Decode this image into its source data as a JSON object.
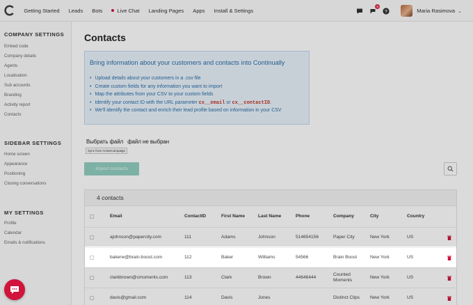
{
  "nav": {
    "items": [
      {
        "label": "Getting Started"
      },
      {
        "label": "Leads"
      },
      {
        "label": "Bots"
      },
      {
        "label": "Live Chat"
      },
      {
        "label": "Landing Pages"
      },
      {
        "label": "Apps"
      },
      {
        "label": "Install & Settings"
      }
    ],
    "notification_count": "5",
    "user_name": "Maria Rasimova"
  },
  "sidebar": {
    "company_heading": "COMPANY SETTINGS",
    "company_items": [
      "Embed code",
      "Company details",
      "Agents",
      "Localisation",
      "Sub accounts",
      "Branding",
      "Activity report",
      "Contacts"
    ],
    "sidebar_heading": "SIDEBAR SETTINGS",
    "sidebar_items": [
      "Home screen",
      "Appearance",
      "Positioning",
      "Closing conversations"
    ],
    "my_heading": "MY SETTINGS",
    "my_items": [
      "Profile",
      "Calendar",
      "Emails & notifications"
    ]
  },
  "main": {
    "title": "Contacts",
    "info_title": "Bring information about your customers and contacts into Continually",
    "info_items": {
      "upload": "Upload details about your customers in a .csv file",
      "fields": "Create custom fields for any information you want to import",
      "map": "Map the attributes from your CSV to your custom fields",
      "identify_prefix": "Identify your contact ID with the URL parameter",
      "identify_code1": "cx__email",
      "identify_or": "or",
      "identify_code2": "cx__contactID",
      "identify_suffix": ".",
      "enrich": "We'll identify the contact and enrich their lead profile based on information in your CSV"
    },
    "file_button": "Выбрать файл",
    "file_status": "файл не выбран",
    "sync_label": "Sync from ActiveCampaign",
    "import_button": "Import contacts"
  },
  "table": {
    "count_label": "4 contacts",
    "columns": [
      "Email",
      "ContactID",
      "First Name",
      "Last Name",
      "Phone",
      "Company",
      "City",
      "Country"
    ],
    "rows": [
      {
        "email": "ajohnson@papercity.com",
        "id": "111",
        "first": "Adams",
        "last": "Johnson",
        "phone": "514654156",
        "company": "Paper City",
        "city": "New York",
        "country": "US"
      },
      {
        "email": "bakerw@brain-boost.com",
        "id": "112",
        "first": "Baker",
        "last": "Williams",
        "phone": "54566",
        "company": "Brain Boost",
        "city": "New York",
        "country": "US"
      },
      {
        "email": "clarkbrown@cmoments.com",
        "id": "113",
        "first": "Clark",
        "last": "Brown",
        "phone": "44646444",
        "company": "Counted Moments",
        "city": "New York",
        "country": "US"
      },
      {
        "email": "davis@gmail.com",
        "id": "114",
        "first": "Davis",
        "last": "Jones",
        "phone": "",
        "company": "Distinct Clips",
        "city": "New York",
        "country": "US"
      }
    ]
  },
  "colors": {
    "brand": "#d0143b",
    "info_text": "#2a6ea8",
    "info_bg": "#e9f3fb",
    "import_button": "#93cfc0"
  },
  "icons": [
    "continually-logo-icon",
    "chat-bubble-icon",
    "bell-icon",
    "help-icon",
    "chevron-down-icon",
    "search-icon",
    "trash-icon",
    "chat-launcher-icon"
  ]
}
